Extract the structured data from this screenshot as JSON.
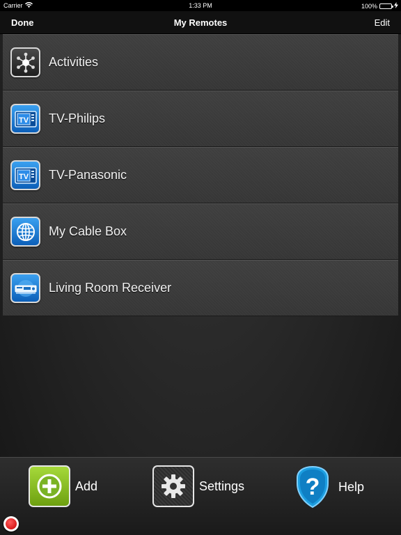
{
  "status_bar": {
    "carrier": "Carrier",
    "time": "1:33 PM",
    "battery": "100%",
    "battery_level": 1.0
  },
  "nav_bar": {
    "left_button": "Done",
    "title": "My Remotes",
    "right_button": "Edit"
  },
  "remotes": [
    {
      "label": "Activities",
      "icon": "activities-hub-icon"
    },
    {
      "label": "TV-Philips",
      "icon": "tv-icon"
    },
    {
      "label": "TV-Panasonic",
      "icon": "tv-icon"
    },
    {
      "label": "My Cable Box",
      "icon": "globe-icon"
    },
    {
      "label": "Living Room Receiver",
      "icon": "receiver-icon"
    }
  ],
  "toolbar": {
    "add_label": "Add",
    "settings_label": "Settings",
    "help_label": "Help"
  },
  "colors": {
    "add_green": "#8cc63f",
    "tv_blue": "#1a7fd8",
    "help_blue": "#1c9ee0",
    "record_red": "#e01010",
    "battery_green": "#4cd964"
  }
}
